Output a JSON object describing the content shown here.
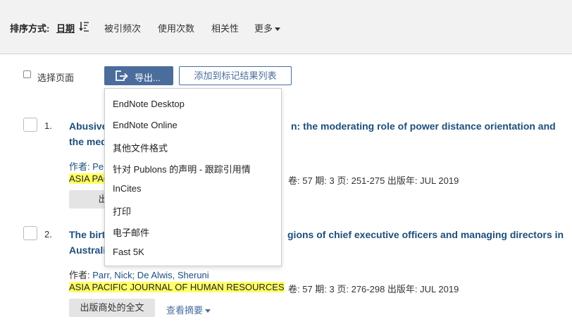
{
  "sort": {
    "label": "排序方式:",
    "date": "日期",
    "citations": "被引频次",
    "usage": "使用次数",
    "relevance": "相关性",
    "more": "更多"
  },
  "toolbar": {
    "select_page": "选择页面",
    "export": "导出...",
    "add_to_marked": "添加到标记结果列表"
  },
  "export_menu": [
    "EndNote Desktop",
    "EndNote Online",
    "其他文件格式",
    "针对 Publons 的声明 - 跟踪引用情",
    "InCites",
    "打印",
    "电子邮件",
    "Fast 5K"
  ],
  "records": [
    {
      "num": "1.",
      "title_line1": "Abusive",
      "title_line1_tail": "n: the moderating role of power distance orientation and",
      "title_line2": "the med",
      "authors_prefix": "作者: Pe",
      "journal": "ASIA PAC",
      "pub_info": "卷: 57  期: 3  页: 251-275  出版年: JUL 2019",
      "fulltext": "出版商"
    },
    {
      "num": "2.",
      "title_line1": "The birt",
      "title_line1_tail": "gions of chief executive officers and managing directors in",
      "title_line2": "Australi",
      "authors_label": "作者: ",
      "authors": "Parr, Nick; De Alwis, Sheruni",
      "journal": "ASIA PACIFIC JOURNAL OF HUMAN RESOURCES",
      "pub_info": "卷: 57  期: 3  页: 276-298  出版年: JUL 2019",
      "fulltext": "出版商处的全文",
      "abstract": "查看摘要"
    }
  ]
}
